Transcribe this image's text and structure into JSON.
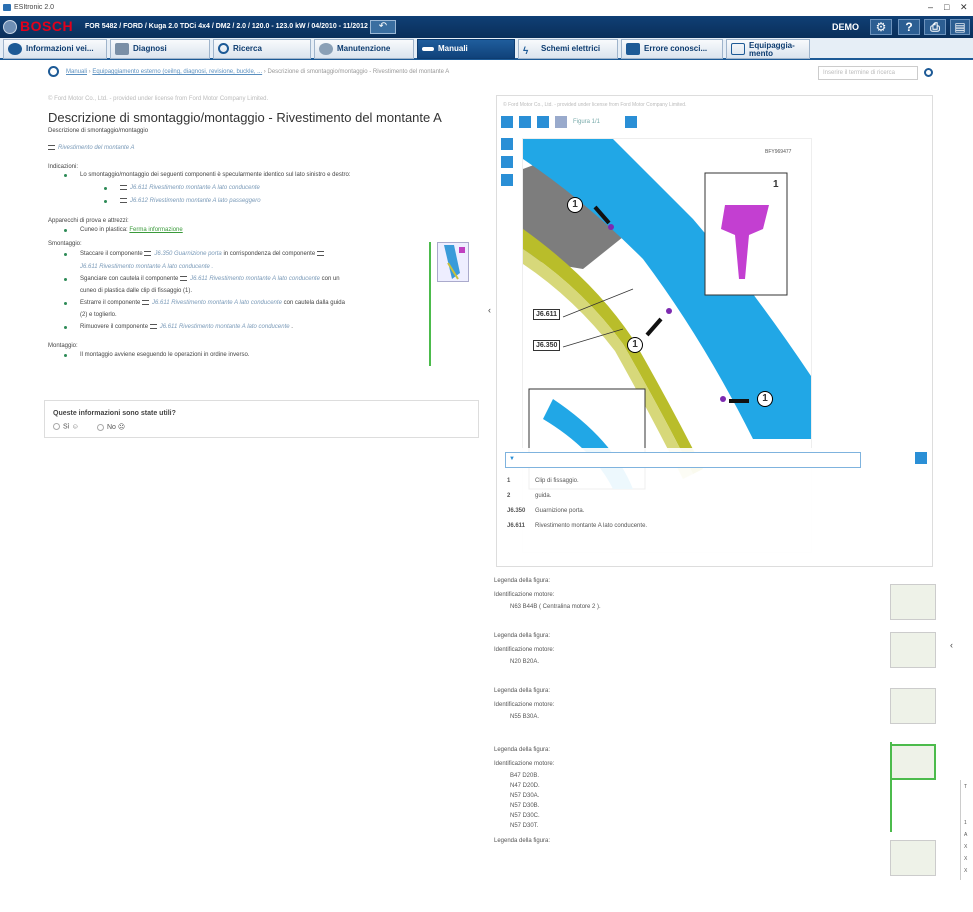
{
  "window": {
    "title": "ESItronic 2.0",
    "controls": [
      "–",
      "□",
      "✕"
    ]
  },
  "header": {
    "brand": "BOSCH",
    "vehicle": "FOR 5482 / FORD / Kuga 2.0 TDCi 4x4 / DM2 / 2.0 / 120.0 - 123.0 kW / 04/2010 - 11/2012 / TXDA",
    "user": "DEMO",
    "help_label": "?",
    "print_label": "⎙"
  },
  "tabs": [
    {
      "label": "Informazioni vei...",
      "icon": "info-icon",
      "active": false
    },
    {
      "label": "Diagnosi",
      "icon": "diagnosis-icon",
      "active": false
    },
    {
      "label": "Ricerca",
      "icon": "search-icon",
      "active": false
    },
    {
      "label": "Manutenzione",
      "icon": "gears-icon",
      "active": false
    },
    {
      "label": "Manuali",
      "icon": "wrench-icon",
      "active": true
    },
    {
      "label": "Schemi elettrici",
      "icon": "lightning-icon",
      "active": false
    },
    {
      "label": "Errore conosci...",
      "icon": "book-icon",
      "active": false
    },
    {
      "label": "Equipaggia-mento",
      "icon": "equipment-icon",
      "active": false
    }
  ],
  "breadcrumb": {
    "link1": "Manuali",
    "sep1": " › ",
    "link2": "Equipaggiamento esterno (ceilng, diagnosi, revisione, buckle, ...",
    "sep2": " › ",
    "current": "Descrizione di smontaggio/montaggio - Rivestimento del montante A"
  },
  "search": {
    "placeholder": "Inserire il termine di ricerca"
  },
  "doc": {
    "copyright": "© Ford Motor Co., Ltd. - provided under license from Ford Motor Company Limited.",
    "title": "Descrizione di smontaggio/montaggio - Rivestimento del montante A",
    "subtitle": "Descrizione di smontaggio/montaggio",
    "component_tag": "Rivestimento del montante A",
    "indications_heading": "Indicazioni:",
    "indication_text": "Lo smontaggio/montaggio dei seguenti componenti è specularmente identico sul lato sinistro e destro:",
    "indication_items": [
      "J6.611 Rivestimento montante A lato conducente",
      "J6.612 Rivestimento montante A lato passeggero"
    ],
    "tools_heading": "Apparecchi di prova e attrezzi:",
    "tools_item": "Cuneo in plastica:",
    "tools_link": "Ferma informazione",
    "removal_heading": "Smontaggio:",
    "removal_steps": [
      {
        "a": "Staccare il componente",
        "b": "J6.350 Guarnizione porta",
        "c": "in corrispondenza del componente"
      },
      {
        "a": "",
        "b": "J6.611 Rivestimento montante A lato conducente",
        "c": "."
      },
      {
        "a": "Sganciare con cautela il componente",
        "b": "J6.611 Rivestimento montante A lato conducente",
        "c": "con un"
      },
      {
        "a": "cuneo di plastica dalle clip di fissaggio (1).",
        "b": "",
        "c": ""
      },
      {
        "a": "Estrarre il componente",
        "b": "J6.611 Rivestimento montante A lato conducente",
        "c": "con cautela dalla guida"
      },
      {
        "a": "(2) e toglierlo.",
        "b": "",
        "c": ""
      },
      {
        "a": "Rimuovere il componente",
        "b": "J6.611 Rivestimento montante A lato conducente",
        "c": "."
      }
    ],
    "mounting_heading": "Montaggio:",
    "mounting_text": "Il montaggio avviene eseguendo le operazioni in ordine inverso.",
    "feedback_question": "Queste informazioni sono state utili?",
    "feedback_yes": "Sì",
    "feedback_no": "No"
  },
  "figure": {
    "copyright": "© Ford Motor Co., Ltd. - provided under license from Ford Motor Company Limited.",
    "figure_label": "Figura 1/1",
    "code": "BFY969477",
    "callouts": {
      "c1": "1",
      "c2": "1",
      "c3": "1",
      "inset": "1",
      "j1": "J6.611",
      "j2": "J6.350"
    },
    "legend_filter": "",
    "legend": [
      {
        "id": "1",
        "text": "Clip di fissaggio."
      },
      {
        "id": "2",
        "text": "guida."
      },
      {
        "id": "J6.350",
        "text": "Guarnizione porta."
      },
      {
        "id": "J6.611",
        "text": "Rivestimento montante A lato conducente."
      }
    ]
  },
  "lower": {
    "blocks": [
      {
        "legend": "Legenda della figura:",
        "ident": "Identificazione motore:",
        "items": [
          "N63 B44B (  Centralina motore 2 )."
        ]
      },
      {
        "legend": "Legenda della figura:",
        "ident": "Identificazione motore:",
        "items": [
          "N20 B20A."
        ]
      },
      {
        "legend": "Legenda della figura:",
        "ident": "Identificazione motore:",
        "items": [
          "N55 B30A."
        ]
      },
      {
        "legend": "Legenda della figura:",
        "ident": "Identificazione motore:",
        "items": [
          "B47 D20B.",
          "N47 D20D.",
          "N57 D30A.",
          "N57 D30B.",
          "N57 D30C.",
          "N57 D30T."
        ]
      },
      {
        "legend": "Legenda della figura:",
        "ident": "",
        "items": []
      }
    ],
    "edge_letters": [
      "T",
      "1",
      "A",
      "X",
      "X",
      "X"
    ]
  },
  "colors": {
    "brand_red": "#e3001b",
    "header_blue": "#0f3f75",
    "accent_green": "#4cbb4c",
    "fig_blue": "#2a8fd6"
  }
}
